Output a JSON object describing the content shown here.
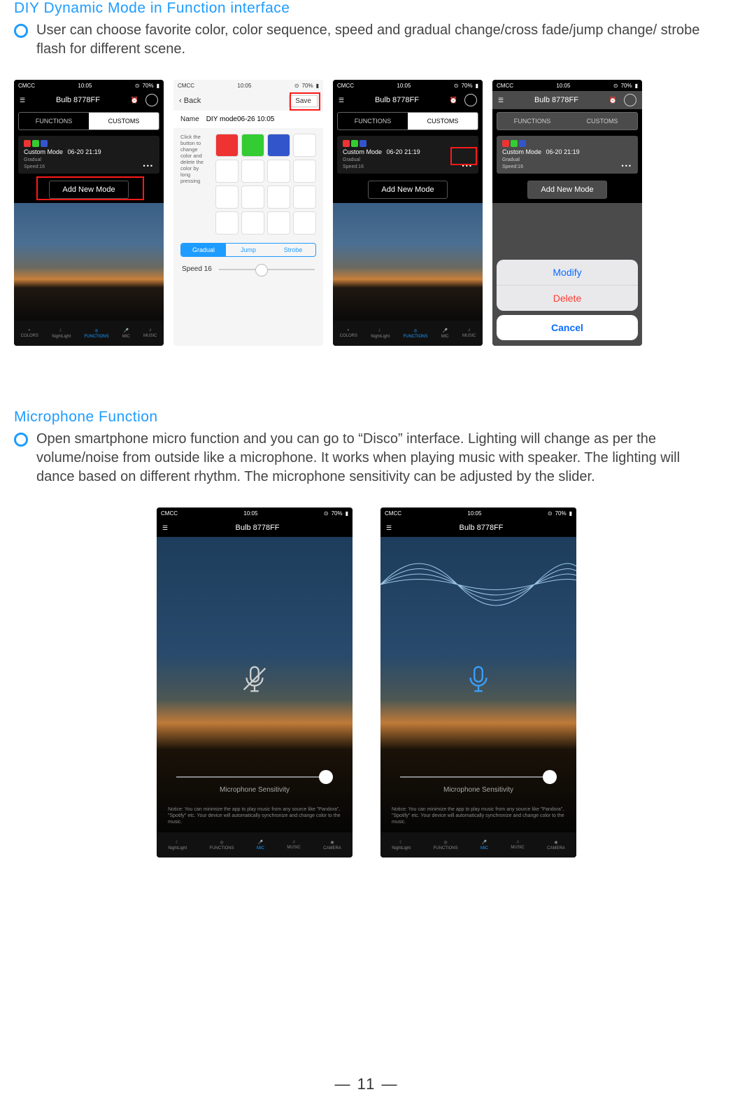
{
  "section1": {
    "title": "DIY Dynamic Mode in Function interface",
    "bullet": "User can choose favorite color, color sequence, speed and gradual change/cross fade/jump change/ strobe flash for different scene."
  },
  "section2": {
    "title": "Microphone Function",
    "bullet": "Open smartphone micro function and you can go to “Disco” interface. Lighting will change as per the volume/noise from outside like a microphone. It works when playing music with speaker. The lighting will dance based on different rhythm. The microphone sensitivity can be adjusted by the slider."
  },
  "status": {
    "carrier": "CMCC",
    "time": "10:05",
    "battery": "70%"
  },
  "device": "Bulb 8778FF",
  "tabs": {
    "functions": "FUNCTIONS",
    "customs": "CUSTOMS"
  },
  "mode": {
    "title": "Custom Mode",
    "ts": "06-20 21:19",
    "gradual": "Gradual",
    "speed": "Speed:16"
  },
  "add": "Add New Mode",
  "nav": {
    "colors": "COLORS",
    "night": "NightLight",
    "functions": "FUNCTIONS",
    "mic": "MIC",
    "music": "MUSIC",
    "camera": "CAMERA"
  },
  "edit": {
    "back": "Back",
    "save": "Save",
    "nameLabel": "Name",
    "nameValue": "DIY mode06-26 10:05",
    "hint": "Click the button to change color and delete the color by long pressing",
    "seg": {
      "gradual": "Gradual",
      "jump": "Jump",
      "strobe": "Strobe"
    },
    "speed": "Speed 16"
  },
  "sheet": {
    "modify": "Modify",
    "delete": "Delete",
    "cancel": "Cancel"
  },
  "mic": {
    "label": "Microphone Sensitivity",
    "notice": "Notice: You can minimize the app to play music from any source like \"Pandora\", \"Spotify\" etc. Your device will automatically synchronize and change color to the music."
  },
  "page": "11"
}
